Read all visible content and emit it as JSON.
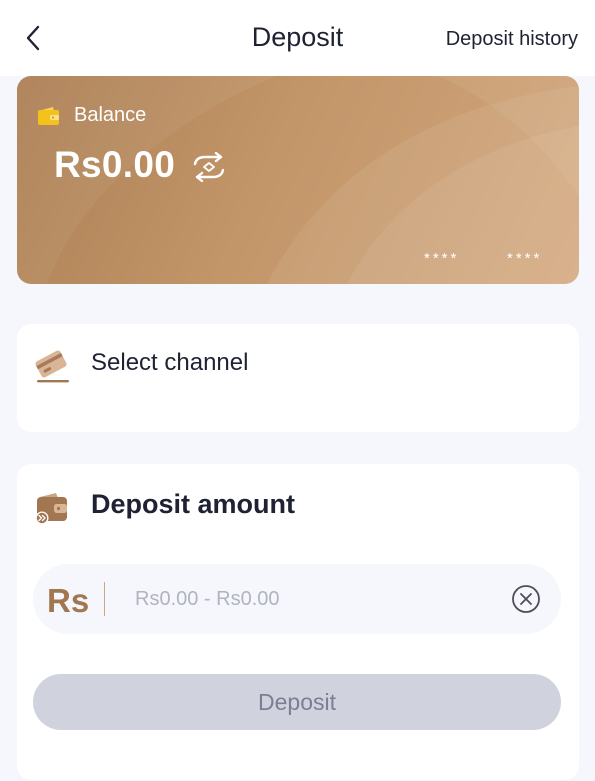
{
  "header": {
    "title": "Deposit",
    "history_link": "Deposit history",
    "back_icon": "chevron-left-icon"
  },
  "balance_card": {
    "label": "Balance",
    "amount": "Rs0.00",
    "masked_groups": [
      "****",
      "****"
    ],
    "wallet_icon": "wallet-icon",
    "refresh_icon": "refresh-icon",
    "colors": {
      "card_start": "#ad7f55",
      "card_end": "#d3a77c"
    }
  },
  "channel": {
    "label": "Select channel",
    "icon": "card-icon"
  },
  "deposit_amount": {
    "title": "Deposit amount",
    "icon": "wallet-transfer-icon",
    "currency_symbol": "Rs",
    "input_value": "",
    "input_placeholder": "Rs0.00 - Rs0.00",
    "clear_icon": "clear-circle-icon",
    "submit_label": "Deposit"
  },
  "colors": {
    "accent": "#a27650",
    "text_primary": "#1e2232",
    "page_background": "#f6f7fc",
    "button_disabled": "#d0d2de"
  }
}
